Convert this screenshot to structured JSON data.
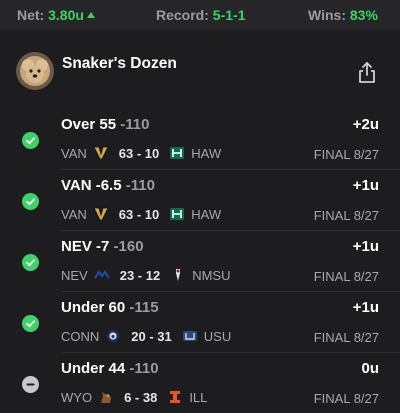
{
  "header": {
    "net_label": "Net:",
    "net_value": "3.80u",
    "record_label": "Record:",
    "record_value": "5-1-1",
    "wins_label": "Wins:",
    "wins_value": "83%"
  },
  "profile": {
    "title": "Snaker's Dozen",
    "share_icon": "share-icon"
  },
  "colors": {
    "positive": "#3fd26b",
    "background": "#1d1d1f",
    "push": "#c8c8cc"
  },
  "bets": [
    {
      "status": "win",
      "pick": "Over 55",
      "odds": "-110",
      "units": "+2u",
      "away": "VAN",
      "score": "63 - 10",
      "home": "HAW",
      "final": "FINAL 8/27",
      "away_icon": "vanderbilt-logo",
      "home_icon": "hawaii-logo"
    },
    {
      "status": "win",
      "pick": "VAN -6.5",
      "odds": "-110",
      "units": "+1u",
      "away": "VAN",
      "score": "63 - 10",
      "home": "HAW",
      "final": "FINAL 8/27",
      "away_icon": "vanderbilt-logo",
      "home_icon": "hawaii-logo"
    },
    {
      "status": "win",
      "pick": "NEV -7",
      "odds": "-160",
      "units": "+1u",
      "away": "NEV",
      "score": "23 - 12",
      "home": "NMSU",
      "final": "FINAL 8/27",
      "away_icon": "nevada-logo",
      "home_icon": "nmsu-logo"
    },
    {
      "status": "win",
      "pick": "Under 60",
      "odds": "-115",
      "units": "+1u",
      "away": "CONN",
      "score": "20 - 31",
      "home": "USU",
      "final": "FINAL 8/27",
      "away_icon": "uconn-logo",
      "home_icon": "usu-logo"
    },
    {
      "status": "push",
      "pick": "Under 44",
      "odds": "-110",
      "units": "0u",
      "away": "WYO",
      "score": "6 - 38",
      "home": "ILL",
      "final": "FINAL 8/27",
      "away_icon": "wyoming-logo",
      "home_icon": "illinois-logo"
    }
  ]
}
